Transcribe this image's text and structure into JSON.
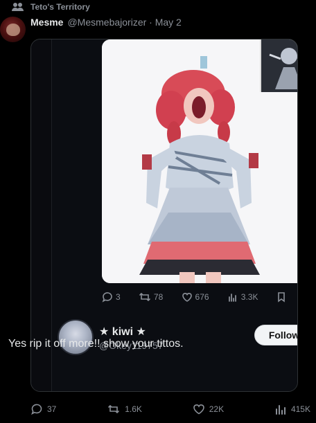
{
  "community": {
    "label": "Teto's Territory",
    "icon": "people-icon"
  },
  "post": {
    "author_name": "Mesme",
    "author_handle": "@Mesmebajorizer · May 2"
  },
  "quoted_media": {
    "actions": {
      "replies": "3",
      "reposts": "78",
      "likes": "676",
      "views": "3.3K"
    }
  },
  "reply": {
    "name": "★ kiwi ★",
    "handle": "@Okey119757",
    "follow_label": "Follow",
    "text": "Yes rip it off more!! show your tittos."
  },
  "footer_actions": {
    "replies": "37",
    "reposts": "1.6K",
    "likes": "22K",
    "views": "415K"
  }
}
